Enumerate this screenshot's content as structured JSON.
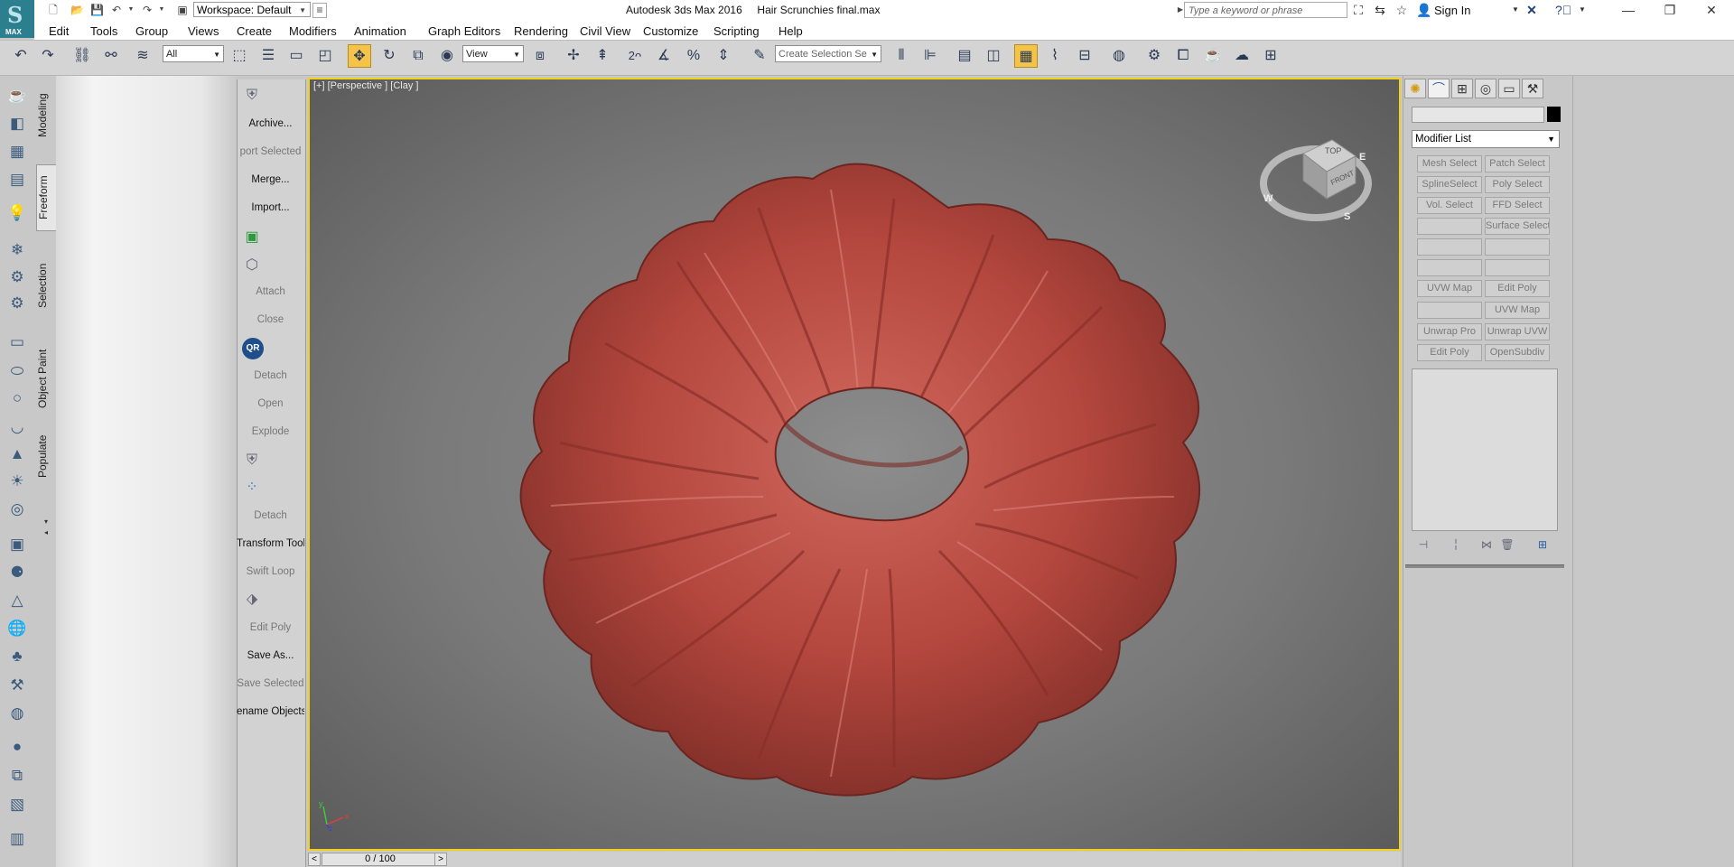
{
  "app": {
    "logo_label": "MAX",
    "title": "Autodesk 3ds Max 2016     Hair Scrunchies final.max",
    "workspace": "Workspace: Default",
    "search_placeholder": "Type a keyword or phrase",
    "sign_in": "Sign In",
    "window_controls": [
      "minimize",
      "maximize",
      "close"
    ]
  },
  "menu": [
    "Edit",
    "Tools",
    "Group",
    "Views",
    "Create",
    "Modifiers",
    "Animation",
    "Graph Editors",
    "Rendering",
    "Civil View",
    "Customize",
    "Scripting",
    "Help"
  ],
  "toolbar": {
    "selection_filter": "All",
    "ref_coord": "View",
    "snap_label": "2",
    "named_selection": "Create Selection Se"
  },
  "ribbon": {
    "tabs": [
      "Modeling",
      "Freeform",
      "Selection",
      "Object Paint",
      "Populate"
    ],
    "active_tab": "Freeform"
  },
  "graphite_items": [
    {
      "label": "Archive...",
      "enabled": true
    },
    {
      "label": "port Selected",
      "enabled": false
    },
    {
      "label": "Merge...",
      "enabled": true
    },
    {
      "label": "Import...",
      "enabled": true
    },
    {
      "label": "Attach",
      "enabled": false
    },
    {
      "label": "Close",
      "enabled": false
    },
    {
      "label": "Detach",
      "enabled": false
    },
    {
      "label": "Open",
      "enabled": false
    },
    {
      "label": "Explode",
      "enabled": false
    },
    {
      "label": "Detach",
      "enabled": false
    },
    {
      "label": "Transform Tool",
      "enabled": true
    },
    {
      "label": "Swift Loop",
      "enabled": false
    },
    {
      "label": "Edit Poly",
      "enabled": false
    },
    {
      "label": "Save As...",
      "enabled": true
    },
    {
      "label": "Save Selected",
      "enabled": false
    },
    {
      "label": "ename Objects",
      "enabled": true
    }
  ],
  "qr_icon_label": "QR",
  "viewport": {
    "label": "[+] [Perspective ] [Clay ]",
    "active_border_color": "#f1d11c",
    "object_color": "#b9483f",
    "viewcube": {
      "top": "TOP",
      "front": "FRONT",
      "west": "W",
      "east": "E",
      "south": "S"
    },
    "axis": {
      "x": "x",
      "y": "y",
      "z": "z"
    }
  },
  "timeline": {
    "position": "0 / 100",
    "prev": "<",
    "next": ">"
  },
  "command_panel": {
    "modifier_list": "Modifier List",
    "buttons": [
      [
        "Mesh Select",
        "Patch Select"
      ],
      [
        "SplineSelect",
        "Poly Select"
      ],
      [
        "Vol. Select",
        "FFD Select"
      ],
      [
        "",
        "Surface Select"
      ],
      [
        "",
        ""
      ],
      [
        "",
        ""
      ],
      [
        "UVW Map",
        "Edit Poly"
      ],
      [
        "",
        "UVW Map"
      ],
      [
        "Unwrap Pro",
        "Unwrap UVW"
      ],
      [
        "Edit Poly",
        "OpenSubdiv"
      ]
    ]
  }
}
